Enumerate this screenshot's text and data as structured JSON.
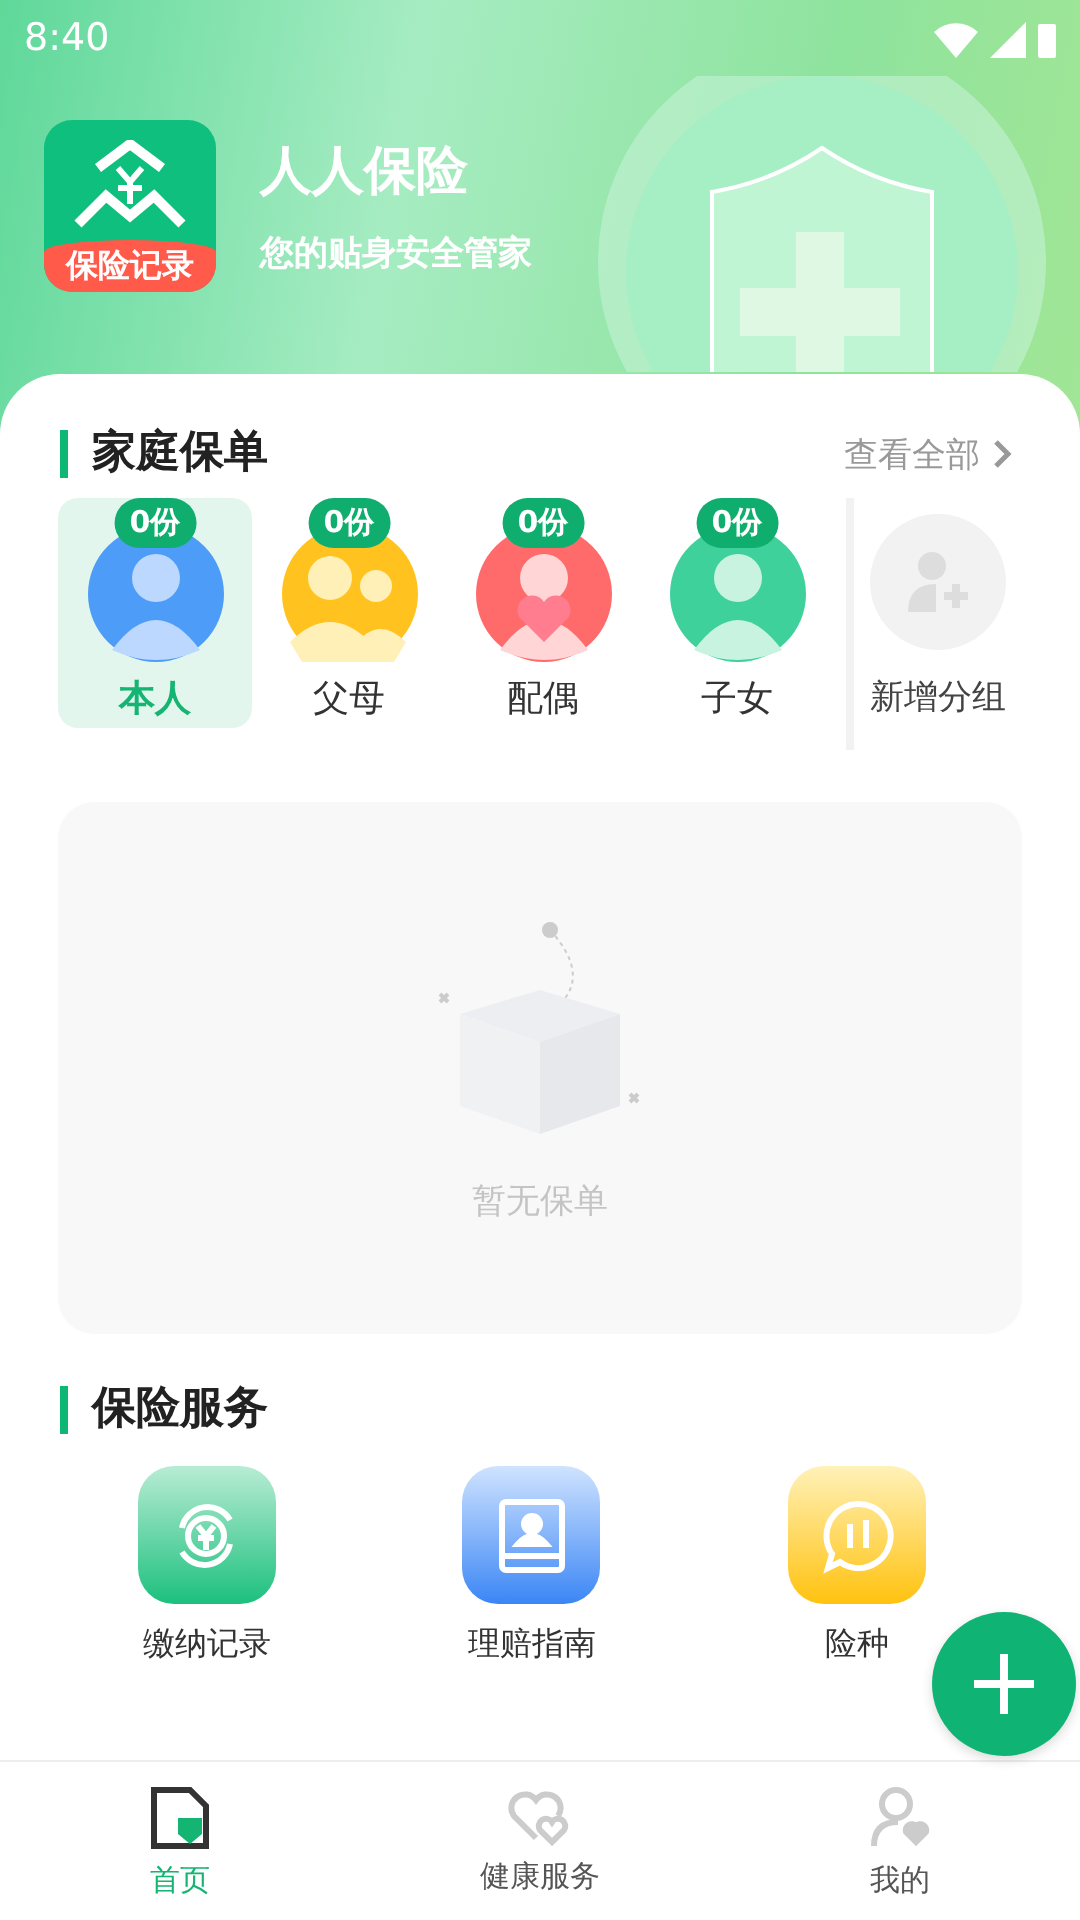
{
  "status_bar": {
    "time": "8:40"
  },
  "header": {
    "logo_label": "保险记录",
    "title": "人人保险",
    "subtitle": "您的贴身安全管家"
  },
  "family": {
    "title": "家庭保单",
    "view_all": "查看全部",
    "members": [
      {
        "kind": "self",
        "count": "0份",
        "label": "本人",
        "selected": true
      },
      {
        "kind": "parents",
        "count": "0份",
        "label": "父母",
        "selected": false
      },
      {
        "kind": "spouse",
        "count": "0份",
        "label": "配偶",
        "selected": false
      },
      {
        "kind": "child",
        "count": "0份",
        "label": "子女",
        "selected": false
      }
    ],
    "add_group": "新增分组",
    "empty_text": "暂无保单"
  },
  "services": {
    "title": "保险服务",
    "items": [
      {
        "kind": "payment",
        "label": "缴纳记录"
      },
      {
        "kind": "guide",
        "label": "理赔指南"
      },
      {
        "kind": "chat",
        "label": "险种"
      }
    ]
  },
  "nav": [
    {
      "kind": "home",
      "label": "首页",
      "selected": true
    },
    {
      "kind": "health",
      "label": "健康服务",
      "selected": false
    },
    {
      "kind": "mine",
      "label": "我的",
      "selected": false
    }
  ]
}
